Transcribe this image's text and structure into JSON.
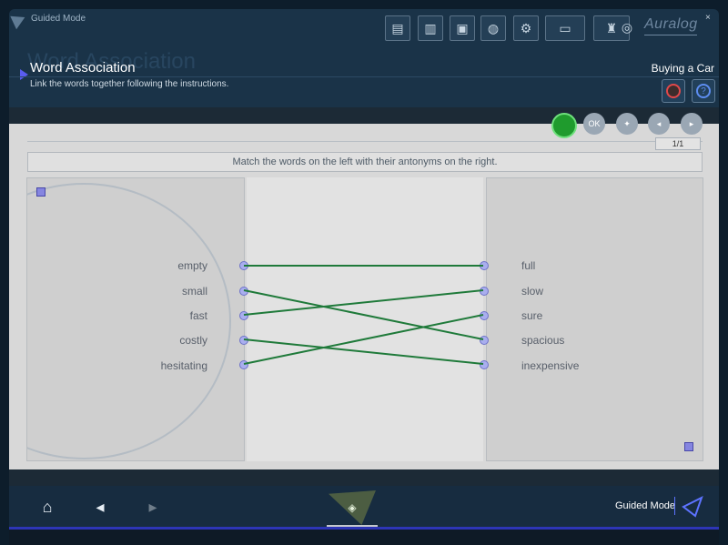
{
  "window": {
    "mode": "Guided Mode",
    "close": "×",
    "brand": "Auralog",
    "ghost_title": "Word Association",
    "title": "Word Association",
    "subtitle": "Link the words together following the instructions.",
    "lesson": "Buying a Car"
  },
  "toolbar": {
    "icons": [
      {
        "name": "notes-icon",
        "glyph": "▤"
      },
      {
        "name": "dialogue-icon",
        "glyph": "▥"
      },
      {
        "name": "ticket-icon",
        "glyph": "▣"
      },
      {
        "name": "globe-icon",
        "glyph": "◍"
      },
      {
        "name": "settings-icon",
        "glyph": "⚙"
      },
      {
        "name": "computer-icon",
        "glyph": "▭"
      },
      {
        "name": "walk-icon",
        "glyph": "♜"
      },
      {
        "name": "globe-grid-icon",
        "glyph": "◎"
      }
    ]
  },
  "controls": {
    "counter": "1/1",
    "ok": "OK"
  },
  "instructions": "Match the words on the left with their antonyms on the right.",
  "left_words": [
    "empty",
    "small",
    "fast",
    "costly",
    "hesitating"
  ],
  "right_words": [
    "full",
    "slow",
    "sure",
    "spacious",
    "inexpensive"
  ],
  "connections": [
    [
      0,
      0
    ],
    [
      1,
      3
    ],
    [
      2,
      1
    ],
    [
      3,
      4
    ],
    [
      4,
      2
    ]
  ],
  "footer": {
    "label": "Guided Mode"
  },
  "colors": {
    "line": "#1f7a3a",
    "accent": "#5a5cf0"
  }
}
